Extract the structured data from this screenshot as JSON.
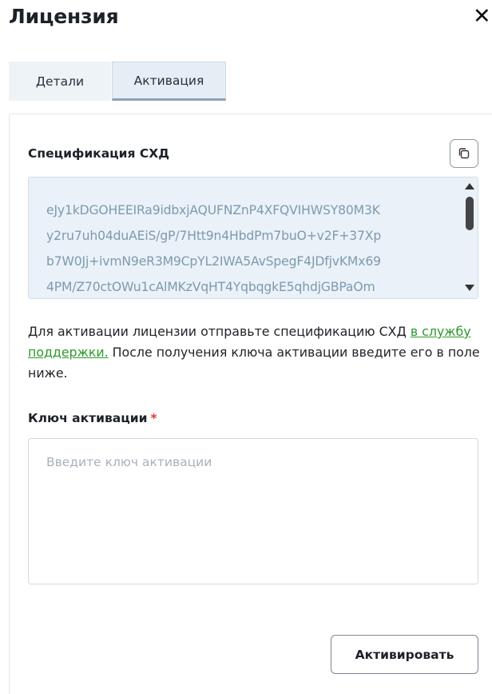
{
  "dialog": {
    "title": "Лицензия",
    "close_icon": "close-icon",
    "close_glyph": "✕"
  },
  "tabs": [
    {
      "label": "Детали",
      "active": false
    },
    {
      "label": "Активация",
      "active": true
    }
  ],
  "specification": {
    "label": "Спецификация СХД",
    "copy_icon": "copy-icon",
    "text": "eJy1kDGOHEEIRa9idbxjAQUFNZnP4XFQVIHWSY80M3K\ny2ru7uh04duAEiS/gP/7Htt9n4HbdPm7buO+v2F+37Xp\nb7W0Jj+ivmN9eR3M9CpYL2IWA5AvSpegF4JDfjvKMx69\n4PM/Z70ctOWu1cAlMKzVqHT4YqbqgkE5qhdjGBPaOm"
  },
  "info": {
    "text_before": "Для активации лицензии отправьте спецификацию СХД ",
    "link": "в службу поддержки.",
    "text_after": " После получения ключа активации введите его в поле ниже."
  },
  "activation_key": {
    "label": "Ключ активации",
    "required_mark": "*",
    "placeholder": "Введите ключ активации",
    "value": ""
  },
  "actions": {
    "activate_label": "Активировать"
  },
  "colors": {
    "link": "#2b9a2b",
    "required": "#d93a3a",
    "spec_text": "#7d9aaf",
    "spec_bg": "#eaf1f8"
  }
}
